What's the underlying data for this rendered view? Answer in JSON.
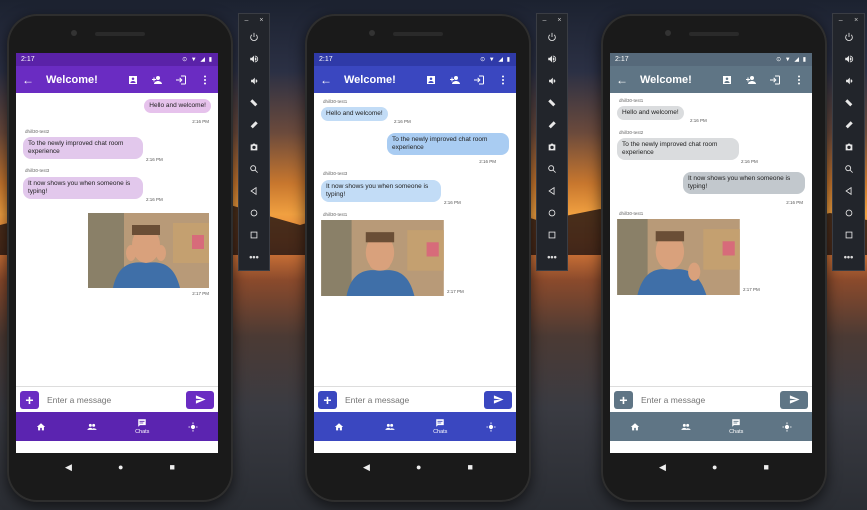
{
  "phones": [
    {
      "theme": {
        "primary": "#6a2cc2",
        "statusbar": "#5a22a8",
        "accent": "#6a2cc2",
        "bubble_own": "#e6c2ec",
        "bubble_other": "#e2c8ec",
        "nav": "#5b24b0"
      },
      "status": {
        "time": "2:17",
        "icons": "⊙ ▼ ◢ ▮"
      },
      "appbar": {
        "title": "Welcome!"
      },
      "messages": [
        {
          "text": "Hello and welcome!",
          "sender": "",
          "time": "2:16 PM",
          "own": true
        },
        {
          "text": "To the newly improved chat room experience",
          "sender": "dhill30-test2",
          "time": "2:16 PM",
          "own": false
        },
        {
          "text": "It now shows you when someone is typing!",
          "sender": "dhill30-test3",
          "time": "2:16 PM",
          "own": false
        },
        {
          "text": "",
          "sender": "",
          "time": "2:17 PM",
          "own": true,
          "image": true
        }
      ],
      "composer": {
        "placeholder": "Enter a message"
      },
      "nav": {
        "chats_label": "Chats"
      }
    },
    {
      "theme": {
        "primary": "#3a47c0",
        "statusbar": "#2f3aa8",
        "accent": "#3a47c0",
        "bubble_own": "#a9ccf2",
        "bubble_other": "#c2dcf6",
        "nav": "#3a47c0"
      },
      "status": {
        "time": "2:17",
        "icons": "⊙ ▼ ◢ ▮"
      },
      "appbar": {
        "title": "Welcome!"
      },
      "messages": [
        {
          "text": "Hello and welcome!",
          "sender": "dhill30-test1",
          "time": "2:16 PM",
          "own": false
        },
        {
          "text": "To the newly improved chat room experience",
          "sender": "",
          "time": "2:16 PM",
          "own": true
        },
        {
          "text": "It now shows you when someone is typing!",
          "sender": "dhill30-test3",
          "time": "2:16 PM",
          "own": false
        },
        {
          "text": "",
          "sender": "dhill30-test1",
          "time": "2:17 PM",
          "own": false,
          "image": true
        }
      ],
      "composer": {
        "placeholder": "Enter a message"
      },
      "nav": {
        "chats_label": "Chats"
      }
    },
    {
      "theme": {
        "primary": "#5f7585",
        "statusbar": "#56697a",
        "accent": "#5f7585",
        "bubble_own": "#c2c8cd",
        "bubble_other": "#dadcde",
        "nav": "#5f7585"
      },
      "status": {
        "time": "2:17",
        "icons": "⊙ ▼ ◢ ▮"
      },
      "appbar": {
        "title": "Welcome!"
      },
      "messages": [
        {
          "text": "Hello and welcome!",
          "sender": "dhill30-test1",
          "time": "2:16 PM",
          "own": false
        },
        {
          "text": "To the newly improved chat room experience",
          "sender": "dhill30-test2",
          "time": "2:16 PM",
          "own": false
        },
        {
          "text": "It now shows you when someone is typing!",
          "sender": "",
          "time": "2:16 PM",
          "own": true
        },
        {
          "text": "",
          "sender": "dhill30-test1",
          "time": "2:17 PM",
          "own": false,
          "image": true
        }
      ],
      "composer": {
        "placeholder": "Enter a message"
      },
      "nav": {
        "chats_label": "Chats"
      }
    }
  ],
  "toolbar": {
    "minimize": "–",
    "close": "×",
    "more": "•••"
  }
}
